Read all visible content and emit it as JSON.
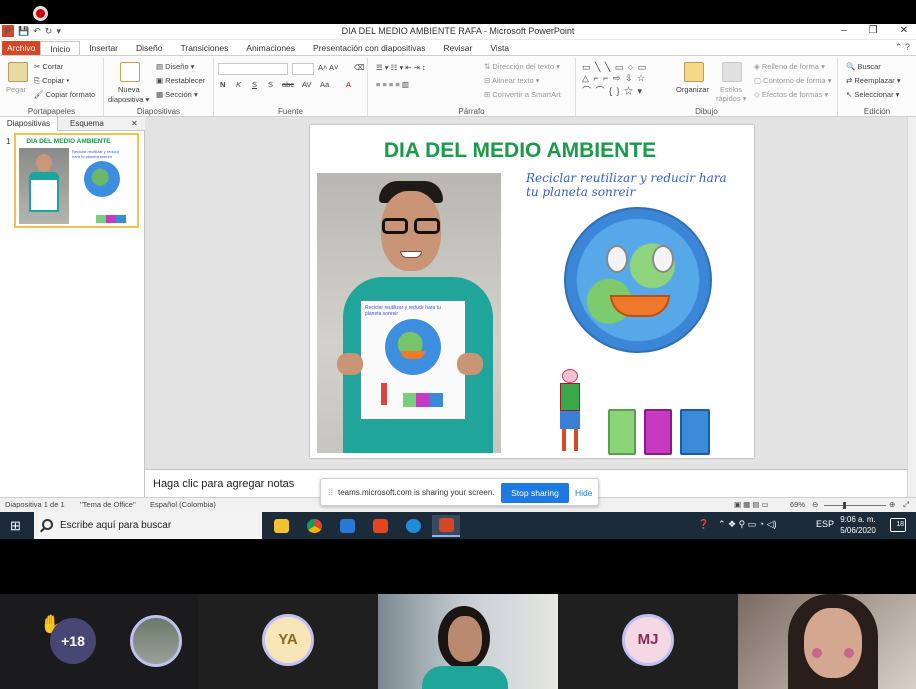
{
  "window": {
    "title": "DIA DEL MEDIO AMBIENTE RAFA  -  Microsoft PowerPoint",
    "controls": [
      "–",
      "❐",
      "✕"
    ]
  },
  "ribbon_tabs": [
    "Archivo",
    "Inicio",
    "Insertar",
    "Diseño",
    "Transiciones",
    "Animaciones",
    "Presentación con diapositivas",
    "Revisar",
    "Vista"
  ],
  "ribbon": {
    "portapapeles": {
      "label": "Portapapeles",
      "pegar": "Pegar",
      "cortar": "Cortar",
      "copiar": "Copiar",
      "copiar_formato": "Copiar formato"
    },
    "diapositivas": {
      "label": "Diapositivas",
      "nueva": "Nueva",
      "diapositiva": "diapositiva",
      "diseno": "Diseño",
      "restablecer": "Restablecer",
      "seccion": "Sección"
    },
    "fuente": {
      "label": "Fuente",
      "buttons": [
        "N",
        "K",
        "S",
        "S",
        "abc",
        "AV",
        "Aa",
        "A"
      ]
    },
    "parrafo": {
      "label": "Párrafo",
      "direccion": "Dirección del texto",
      "alinear": "Alinear texto",
      "smartart": "Convertir a SmartArt"
    },
    "dibujo": {
      "label": "Dibujo",
      "organizar": "Organizar",
      "estilos": "Estilos",
      "rapidos": "rápidos",
      "relleno": "Relleno de forma",
      "contorno": "Contorno de forma",
      "efectos": "Efectos de formas"
    },
    "edicion": {
      "label": "Edición",
      "buscar": "Buscar",
      "reemplazar": "Reemplazar",
      "seleccionar": "Seleccionar"
    }
  },
  "left_pane": {
    "tab_slides": "Diapositivas",
    "tab_outline": "Esquema",
    "close": "✕",
    "slide_number": "1"
  },
  "slide": {
    "title": "DIA DEL MEDIO AMBIENTE",
    "handwriting": "Reciclar reutilizar y reducir hara tu planeta sonreir"
  },
  "notes_placeholder": "Haga clic para agregar notas",
  "share_bar": {
    "grip": "⁞⁞",
    "text": "teams.microsoft.com is sharing your screen.",
    "stop": "Stop sharing",
    "hide": "Hide"
  },
  "status": {
    "slide": "Diapositiva 1 de 1",
    "theme": "\"Tema de Office\"",
    "language": "Español (Colombia)",
    "zoom": "69%",
    "zoom_fraction": 0.69
  },
  "taskbar": {
    "search_placeholder": "Escribe aquí para buscar",
    "lang": "ESP",
    "time": "9:06 a. m.",
    "date": "5/06/2020",
    "notif_count": "18"
  },
  "participants": {
    "extra_count": "+18",
    "initials": [
      "YA",
      "MJ"
    ]
  },
  "colors": {
    "title_green": "#1a9a4a",
    "ppt_orange": "#d24726",
    "teams_blue": "#1e7ae0",
    "teams_purple": "#464775",
    "taskbar": "#1c2b3a"
  }
}
